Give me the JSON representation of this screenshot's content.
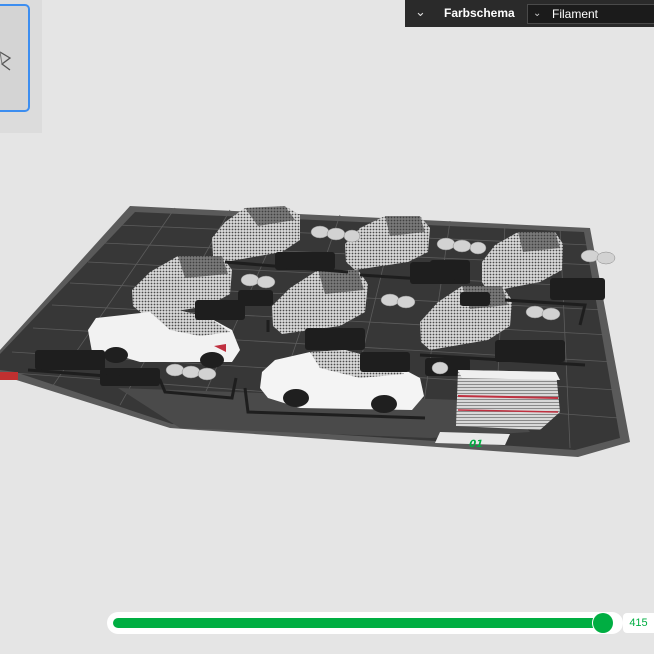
{
  "toolbar": {
    "collapse_icon": "double-chevron-down",
    "color_scheme_label": "Farbschema",
    "color_scheme_value": "Filament"
  },
  "plate": {
    "label_back": "01"
  },
  "layer_slider": {
    "value": "415",
    "fill_fraction": 0.96
  },
  "colors": {
    "accent": "#00ae42",
    "selection": "#3d8ef0",
    "plate": "#353535",
    "toolbar": "#2a2a2a"
  }
}
